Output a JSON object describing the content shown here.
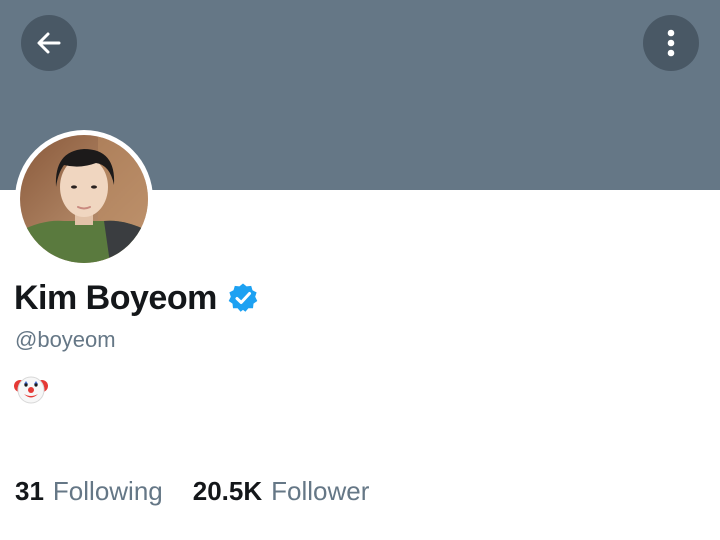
{
  "profile": {
    "display_name": "Kim Boyeom",
    "handle": "@boyeom",
    "bio_emoji": "clown-face-emoji",
    "verified": true
  },
  "stats": {
    "following_count": "31",
    "following_label": "Following",
    "follower_count": "20.5K",
    "follower_label": "Follower"
  },
  "icons": {
    "back": "arrow-left-icon",
    "more": "vertical-dots-icon",
    "verified": "verified-badge-icon"
  },
  "colors": {
    "banner": "#657786",
    "verified_blue": "#1da1f2",
    "secondary_text": "#657786",
    "primary_text": "#14171a"
  }
}
